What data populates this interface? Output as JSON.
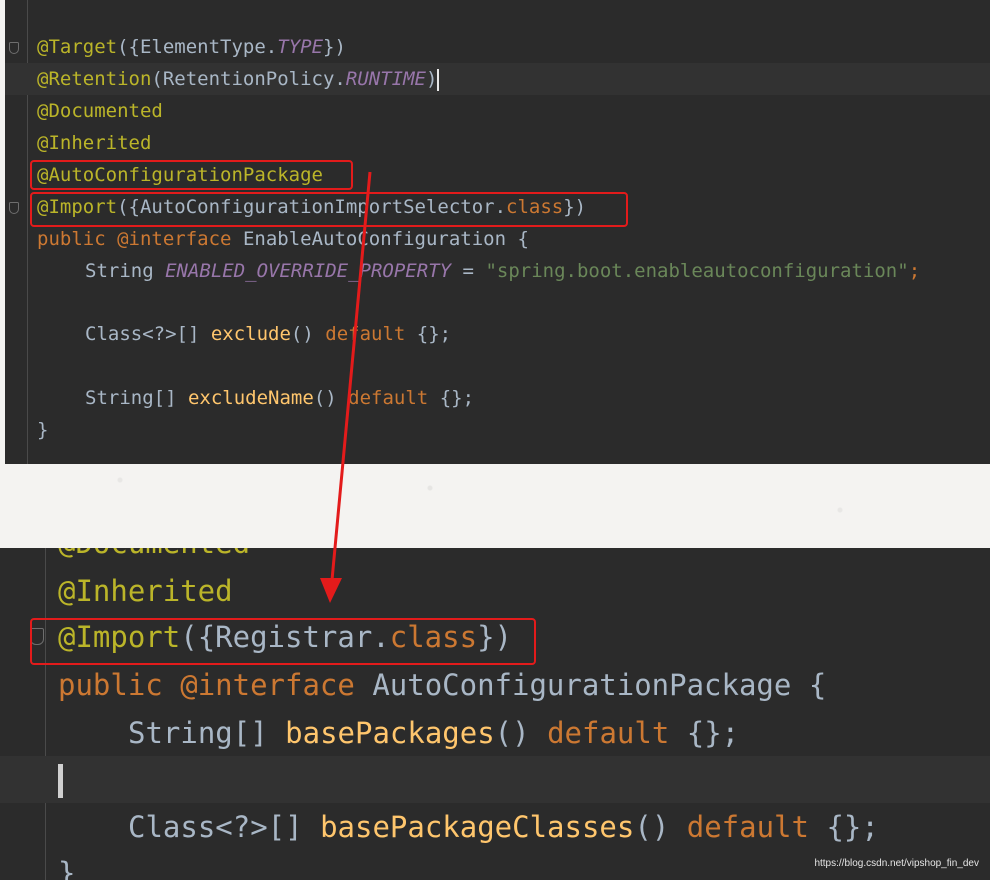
{
  "top_snippet": {
    "lines": [
      {
        "annotation_at": "@",
        "annotation_name": "Target",
        "rest_open": "({ElementType.",
        "italic": "TYPE",
        "rest_close": "})"
      },
      {
        "annotation_at": "@",
        "annotation_name": "Retention",
        "rest_open": "(RetentionPolicy.",
        "italic": "RUNTIME",
        "rest_close": ")"
      },
      {
        "annotation": "@Documented"
      },
      {
        "annotation": "@Inherited"
      },
      {
        "annotation": "@AutoConfigurationPackage"
      },
      {
        "annotation_at": "@",
        "annotation_name": "Import",
        "rest_open": "({AutoConfigurationImportSelector.",
        "keyword": "class",
        "rest_close": "})"
      },
      {
        "kw_public": "public",
        "kw_interface": "@interface",
        "name": "EnableAutoConfiguration",
        "brace": "{"
      },
      {
        "type": "String",
        "const": "ENABLED_OVERRIDE_PROPERTY",
        "eq": "=",
        "string": "\"spring.boot.enableautoconfiguration\"",
        "semi": ";"
      },
      {
        "type": "Class<?>[]",
        "method": "exclude",
        "parens": "()",
        "kw_default": "default",
        "tail": "{};"
      },
      {
        "type": "String[]",
        "method": "excludeName",
        "parens": "()",
        "kw_default": "default",
        "tail": "{};"
      },
      {
        "close": "}"
      }
    ]
  },
  "bottom_snippet": {
    "lines": [
      {
        "partial": "@Documented"
      },
      {
        "annotation": "@Inherited"
      },
      {
        "annotation_at": "@",
        "annotation_name": "Import",
        "rest_open": "({Registrar.",
        "keyword": "class",
        "rest_close": "})"
      },
      {
        "kw_public": "public",
        "kw_interface": "@interface",
        "name": "AutoConfigurationPackage",
        "brace": "{"
      },
      {
        "type": "String[]",
        "method": "basePackages",
        "parens": "()",
        "kw_default": "default",
        "tail": "{};"
      },
      {
        "type": "Class<?>[]",
        "method": "basePackageClasses",
        "parens": "()",
        "kw_default": "default",
        "tail": "{};"
      },
      {
        "close": "}"
      }
    ]
  },
  "watermark": "https://blog.csdn.net/vipshop_fin_dev",
  "colors": {
    "highlight_box": "#e31b1b",
    "arrow": "#e31b1b",
    "editor_bg": "#2b2b2b"
  }
}
